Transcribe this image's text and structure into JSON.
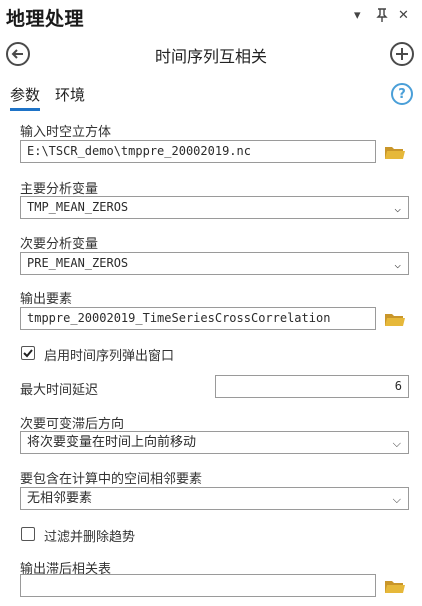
{
  "header": {
    "pane_title": "地理处理",
    "tool_title": "时间序列互相关"
  },
  "window_controls": {
    "menu": "▾",
    "pin": "ᵖ",
    "close": "✕"
  },
  "nav": {
    "back_symbol": "←",
    "add_symbol": "+"
  },
  "tabs": [
    {
      "label": "参数",
      "active": true
    },
    {
      "label": "环境",
      "active": false
    }
  ],
  "help": {
    "symbol": "?"
  },
  "params": {
    "input_cube": {
      "label": "输入时空立方体",
      "value": "E:\\TSCR_demo\\tmppre_20002019.nc"
    },
    "primary_var": {
      "label": "主要分析变量",
      "value": "TMP_MEAN_ZEROS"
    },
    "secondary_var": {
      "label": "次要分析变量",
      "value": "PRE_MEAN_ZEROS"
    },
    "output_features": {
      "label": "输出要素",
      "value": "tmppre_20002019_TimeSeriesCrossCorrelation"
    },
    "enable_popup": {
      "label": "启用时间序列弹出窗口",
      "checked": true
    },
    "max_lag": {
      "label": "最大时间延迟",
      "value": "6"
    },
    "lag_direction": {
      "label": "次要可变滞后方向",
      "value": "将次要变量在时间上向前移动"
    },
    "neighbors": {
      "label": "要包含在计算中的空间相邻要素",
      "value": "无相邻要素"
    },
    "detrend": {
      "label": "过滤并删除趋势",
      "checked": false
    },
    "output_table": {
      "label": "输出滞后相关表",
      "value": ""
    }
  },
  "colors": {
    "folder": "#e6b83a",
    "folder_dark": "#c9962a",
    "accent": "#1e73c7",
    "help": "#4a9fd8"
  }
}
